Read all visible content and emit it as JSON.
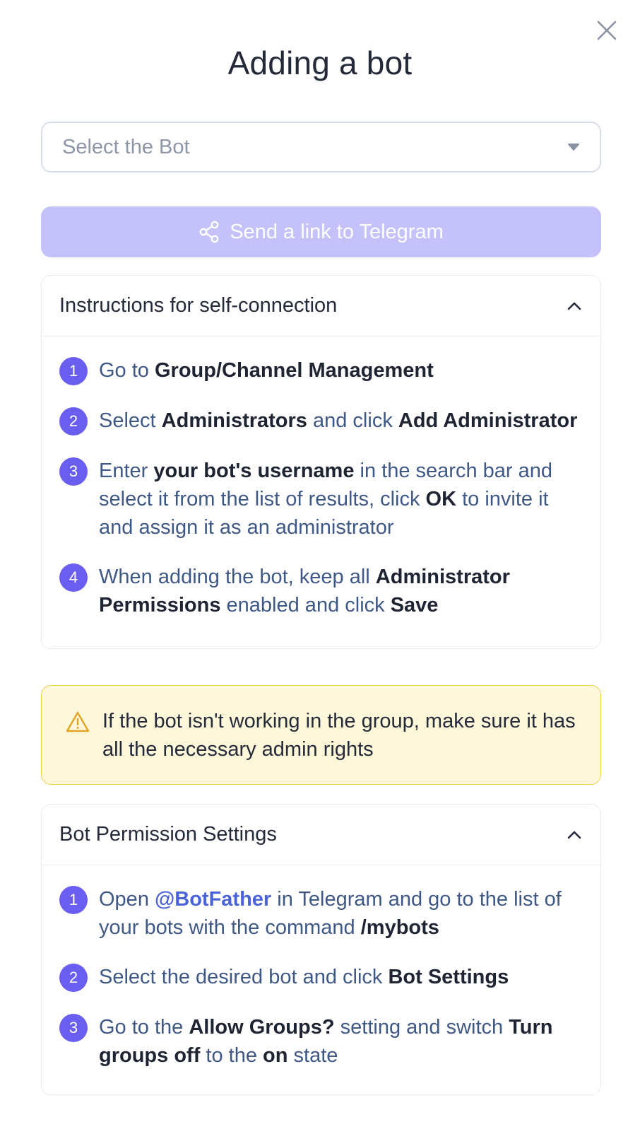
{
  "dialog": {
    "title": "Adding a bot",
    "close_icon": "close-icon"
  },
  "bot_select": {
    "placeholder": "Select the Bot",
    "caret_icon": "caret-down-icon"
  },
  "send_button": {
    "label": "Send a link to Telegram",
    "icon": "share-icon",
    "color": "#c5c1fb"
  },
  "instructions": {
    "title": "Instructions for self-connection",
    "chevron_icon": "chevron-up-icon",
    "steps": [
      {
        "number": "1",
        "segments": [
          {
            "text": "Go to ",
            "bold": false
          },
          {
            "text": "Group/Channel Management",
            "bold": true
          }
        ]
      },
      {
        "number": "2",
        "segments": [
          {
            "text": "Select ",
            "bold": false
          },
          {
            "text": "Administrators",
            "bold": true
          },
          {
            "text": " and click ",
            "bold": false
          },
          {
            "text": "Add Administrator",
            "bold": true
          }
        ]
      },
      {
        "number": "3",
        "segments": [
          {
            "text": "Enter ",
            "bold": false
          },
          {
            "text": "your bot's username",
            "bold": true
          },
          {
            "text": " in the search bar and select it from the list of results, click ",
            "bold": false
          },
          {
            "text": "OK",
            "bold": true
          },
          {
            "text": " to invite it and assign it as an administrator",
            "bold": false
          }
        ]
      },
      {
        "number": "4",
        "segments": [
          {
            "text": "When adding the bot, keep all ",
            "bold": false
          },
          {
            "text": "Administrator Permissions",
            "bold": true
          },
          {
            "text": " enabled and click ",
            "bold": false
          },
          {
            "text": "Save",
            "bold": true
          }
        ]
      }
    ]
  },
  "warning": {
    "icon": "warning-triangle-icon",
    "text": "If the bot isn't working in the group, make sure it has all the necessary admin rights",
    "background": "#fef7da",
    "border": "#f0ce4a"
  },
  "permissions": {
    "title": "Bot Permission Settings",
    "chevron_icon": "chevron-up-icon",
    "steps": [
      {
        "number": "1",
        "segments": [
          {
            "text": "Open ",
            "bold": false
          },
          {
            "text": "@BotFather",
            "bold": true,
            "link": true
          },
          {
            "text": " in Telegram and go to the list of your bots with the command ",
            "bold": false
          },
          {
            "text": "/mybots",
            "bold": true
          }
        ]
      },
      {
        "number": "2",
        "segments": [
          {
            "text": "Select the desired bot and click ",
            "bold": false
          },
          {
            "text": "Bot Settings",
            "bold": true
          }
        ]
      },
      {
        "number": "3",
        "segments": [
          {
            "text": "Go to the ",
            "bold": false
          },
          {
            "text": "Allow Groups?",
            "bold": true
          },
          {
            "text": " setting and switch ",
            "bold": false
          },
          {
            "text": "Turn groups off",
            "bold": true
          },
          {
            "text": " to the ",
            "bold": false
          },
          {
            "text": "on",
            "bold": true
          },
          {
            "text": " state",
            "bold": false
          }
        ]
      }
    ]
  },
  "colors": {
    "accent": "#6a5ef0",
    "step_text": "#3f5886",
    "link": "#4b63d8"
  }
}
